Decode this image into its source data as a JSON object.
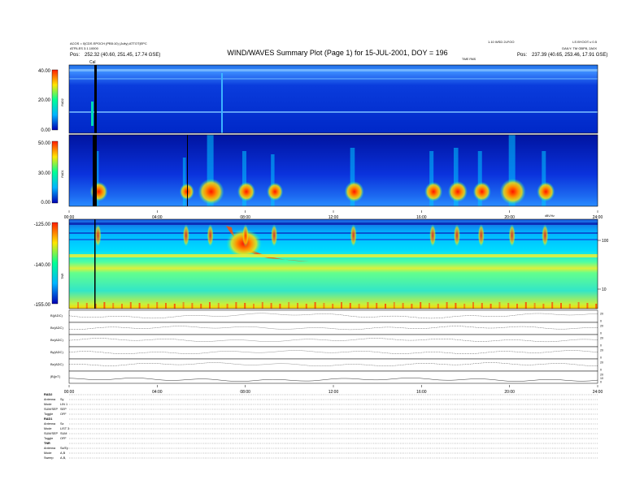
{
  "header": {
    "title": "WIND/WAVES Summary Plot (Page 1) for 15-JUL-2001, DOY = 196",
    "left_line1": "ACOS = 0|CDS EPOCH (PB5:10) (Julty)  ATTOT|EPC",
    "left_line2": "ATFILES 3.1.10000",
    "left_pos_label": "Pos:",
    "left_pos_value": "252.32 (40.60, 251.45, 17.74 GSE)",
    "right_line1": "1.10 WSD 2LFOO",
    "right_line1b": "LS BYOOT-v 0.5",
    "right_line2": "DAILY: TM GBP8, 2A0X",
    "right_pos_label": "Pos:",
    "right_pos_value": "237.39 (40.65, 253.46, 17.91 GSE)",
    "time_label": "TIME RMS",
    "cal_marker": "Cal"
  },
  "panels": [
    {
      "name": "RAD2",
      "ticks": [
        "40.00",
        "20.00",
        "0.00"
      ]
    },
    {
      "name": "RAD1",
      "ticks": [
        "50.00",
        "30.00",
        "0.00"
      ]
    },
    {
      "name": "TNR",
      "ticks": [
        "-125.00",
        "-140.00",
        "-155.00"
      ]
    }
  ],
  "tnr_right_axis": {
    "label": "dBV/Hz",
    "ticks": [
      "100",
      "10"
    ]
  },
  "time_axis_1": [
    "00:00",
    "04:00",
    "08:00",
    "12:00",
    "16:00",
    "20:00",
    "24:00"
  ],
  "time_axis_2": [
    "00:00",
    "04:00",
    "08:00",
    "12:00",
    "16:00",
    "20:00",
    "24:00"
  ],
  "mag_panels": [
    {
      "name": "B|(ADC)",
      "right_ticks": [
        "20",
        "0"
      ]
    },
    {
      "name": "Bx(ADC)",
      "right_ticks": [
        "20",
        "0"
      ]
    },
    {
      "name": "Bx(ADC)",
      "right_ticks": [
        "20",
        "0"
      ]
    },
    {
      "name": "By(ADC)",
      "right_ticks": [
        "20",
        "0"
      ]
    },
    {
      "name": "Bz(ADC)",
      "right_ticks": [
        "20",
        "0"
      ]
    },
    {
      "name": "|B|(nT)",
      "right_ticks": [
        "20",
        "10",
        "0"
      ]
    }
  ],
  "mode_table": {
    "rows": [
      {
        "label": "RAD2",
        "value": ""
      },
      {
        "label": "Antenna",
        "value": "Sy"
      },
      {
        "label": "Mode",
        "value": "LIN 1"
      },
      {
        "label": "SUM/SEP",
        "value": "SEP"
      },
      {
        "label": "Toggle",
        "value": "OFF"
      },
      {
        "label": "RAD1",
        "value": ""
      },
      {
        "label": "Antenna",
        "value": "Sz"
      },
      {
        "label": "Mode",
        "value": "LIST 3"
      },
      {
        "label": "SUM/SEP",
        "value": "SUM"
      },
      {
        "label": "Toggle",
        "value": "OFF"
      },
      {
        "label": "TNR",
        "value": ""
      },
      {
        "label": "Antenna",
        "value": "Sz/Ey"
      },
      {
        "label": "Mode",
        "value": "A,B"
      },
      {
        "label": "Sweep",
        "value": "A,B,"
      }
    ]
  },
  "chart_data": {
    "type": "heatmap",
    "title": "WIND/WAVES Summary Plot (Page 1) for 15-JUL-2001, DOY = 196",
    "xlabel": "",
    "x_ticks": [
      "00:00",
      "04:00",
      "08:00",
      "12:00",
      "16:00",
      "20:00",
      "24:00"
    ],
    "xlim_hours": [
      0,
      24
    ],
    "series": [
      {
        "name": "RAD2",
        "colorbar_range": [
          0,
          40
        ]
      },
      {
        "name": "RAD1",
        "colorbar_range": [
          0,
          50
        ]
      },
      {
        "name": "TNR",
        "colorbar_range": [
          -155,
          -125
        ]
      }
    ],
    "bursts_hours": [
      1.2,
      5.2,
      6.3,
      7.9,
      9.2,
      12.8,
      16.4,
      17.5,
      18.6,
      20.0,
      21.5
    ],
    "colors": {
      "low": "#0000c8",
      "mid": "#00d7ff",
      "mid2": "#5aff8c",
      "high": "#ffe600",
      "peak": "#ff2800"
    }
  }
}
